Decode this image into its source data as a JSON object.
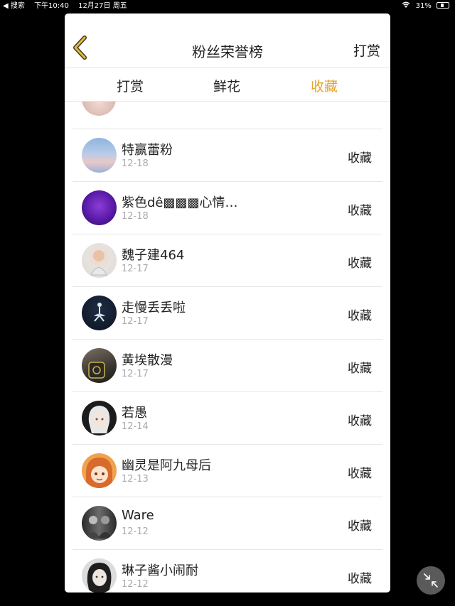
{
  "status_bar": {
    "back_label": "◀ 搜索",
    "time": "下午10:40",
    "date": "12月27日 周五",
    "battery": "31%",
    "battery_level": 0.31
  },
  "nav": {
    "title": "粉丝荣誉榜",
    "right_button": "打赏"
  },
  "tabs": [
    {
      "label": "打赏",
      "active": false
    },
    {
      "label": "鲜花",
      "active": false
    },
    {
      "label": "收藏",
      "active": true
    }
  ],
  "colors": {
    "accent": "#e7a32c"
  },
  "fans": [
    {
      "name": "特赢蕾粉",
      "date": "12-18",
      "action": "收藏",
      "avatar": "sky-avatar"
    },
    {
      "name": "紫色dê▩▩▩心情…",
      "date": "12-18",
      "action": "收藏",
      "avatar": "purple-avatar"
    },
    {
      "name": "魏子建464",
      "date": "12-17",
      "action": "收藏",
      "avatar": "child-avatar"
    },
    {
      "name": "走慢丢丢啦",
      "date": "12-17",
      "action": "收藏",
      "avatar": "dancer-avatar"
    },
    {
      "name": "黄埃散漫",
      "date": "12-17",
      "action": "收藏",
      "avatar": "object-avatar"
    },
    {
      "name": "若愚",
      "date": "12-14",
      "action": "收藏",
      "avatar": "anime-white-hair-avatar"
    },
    {
      "name": "幽灵是阿九母后",
      "date": "12-13",
      "action": "收藏",
      "avatar": "anime-girl-avatar"
    },
    {
      "name": "Ware",
      "date": "12-12",
      "action": "收藏",
      "avatar": "bw-photo-avatar"
    },
    {
      "name": "琳子酱小闹耐",
      "date": "12-12",
      "action": "收藏",
      "avatar": "portrait-avatar"
    }
  ]
}
